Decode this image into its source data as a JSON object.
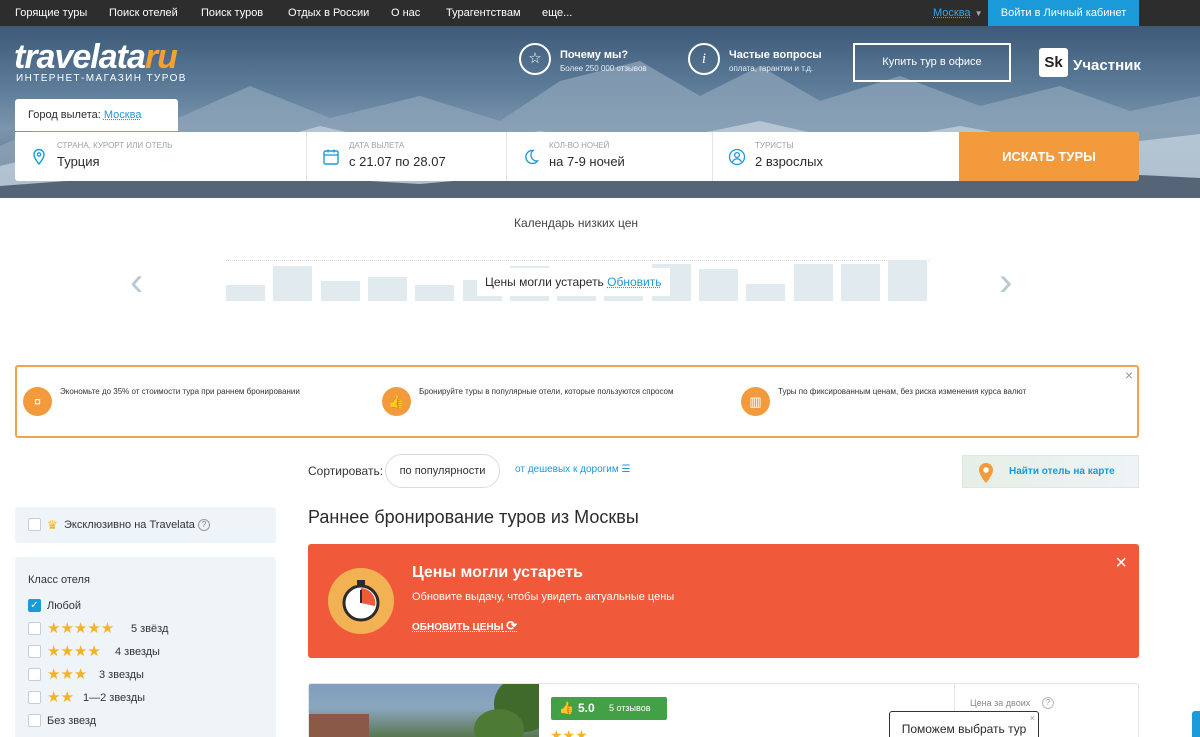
{
  "topnav": {
    "items": [
      "Горящие туры",
      "Поиск отелей",
      "Поиск туров",
      "Отдых в России",
      "О нас",
      "Турагентствам",
      "еще..."
    ],
    "city": "Москва",
    "login": "Войти в Личный кабинет"
  },
  "logo": {
    "main": "travelata",
    "ru": "ru",
    "sub": "ИНТЕРНЕТ-МАГАЗИН ТУРОВ"
  },
  "header": {
    "why_title": "Почему мы?",
    "why_sub": "Более 250 000 отзывов",
    "faq_title": "Частые вопросы",
    "faq_sub": "оплата, гарантии и т.д.",
    "buy_office": "Купить тур в офисе",
    "sk_logo": "Sk",
    "sk_label": "Участник"
  },
  "departure": {
    "label": "Город вылета:",
    "city": "Москва"
  },
  "search": {
    "fields": [
      {
        "label": "СТРАНА, КУРОРТ ИЛИ ОТЕЛЬ",
        "value": "Турция",
        "icon": "location-pin-icon"
      },
      {
        "label": "ДАТА ВЫЛЕТА",
        "value": "с 21.07 по 28.07",
        "icon": "calendar-icon"
      },
      {
        "label": "КОЛ-ВО НОЧЕЙ",
        "value": "на 7-9 ночей",
        "icon": "moon-icon"
      },
      {
        "label": "ТУРИСТЫ",
        "value": "2 взрослых",
        "icon": "user-icon"
      }
    ],
    "button": "ИСКАТЬ ТУРЫ"
  },
  "calendar": {
    "title": "Календарь низких цен",
    "outdated": "Цены могли устареть",
    "refresh": "Обновить",
    "bar_levels": [
      0.4,
      0.85,
      0.48,
      0.58,
      0.4,
      0.5,
      0.85,
      0.5,
      0.62,
      0.9,
      0.78,
      0.42,
      0.9,
      0.9,
      1.0
    ]
  },
  "promo": {
    "items": [
      {
        "text": "Экономьте до 35% от стоимости тура при раннем бронировании",
        "icon": "piggy-bank-icon"
      },
      {
        "text": "Бронируйте туры в популярные отели, которые пользуются спросом",
        "icon": "thumbs-up-icon"
      },
      {
        "text": "Туры по фиксированным ценам, без риска изменения курса валют",
        "icon": "chart-icon"
      }
    ],
    "close": "×"
  },
  "sort": {
    "label": "Сортировать:",
    "active": "по популярности",
    "other": "от дешевых к дорогим"
  },
  "map_button": "Найти отель на карте",
  "filters": {
    "exclusive": "Эксклюзивно на Travelata",
    "exclusive_help": "?",
    "hotel_class_title": "Класс отеля",
    "options": [
      {
        "label": "Любой",
        "checked": true,
        "stars": 0
      },
      {
        "label": "5 звёзд",
        "checked": false,
        "stars": 5
      },
      {
        "label": "4 звезды",
        "checked": false,
        "stars": 4
      },
      {
        "label": "3 звезды",
        "checked": false,
        "stars": 3
      },
      {
        "label": "1—2 звезды",
        "checked": false,
        "stars": 2
      },
      {
        "label": "Без звезд",
        "checked": false,
        "stars": 0
      }
    ]
  },
  "results": {
    "title": "Раннее бронирование туров из Москвы",
    "banner": {
      "title": "Цены могли устареть",
      "subtitle": "Обновите выдачу, чтобы увидеть актуальные цены",
      "link": "ОБНОВИТЬ ЦЕНЫ",
      "close": "×"
    },
    "card": {
      "rating": "5.0",
      "reviews": "5 отзывов",
      "stars": 3,
      "price_label": "Цена за двоих",
      "price_help": "?"
    }
  },
  "help_popup": {
    "text": "Поможем выбрать тур",
    "close": "×"
  },
  "colors": {
    "accent": "#f39a3d",
    "link": "#1a9ad8",
    "banner": "#f05a3a",
    "rating": "#43a047"
  }
}
